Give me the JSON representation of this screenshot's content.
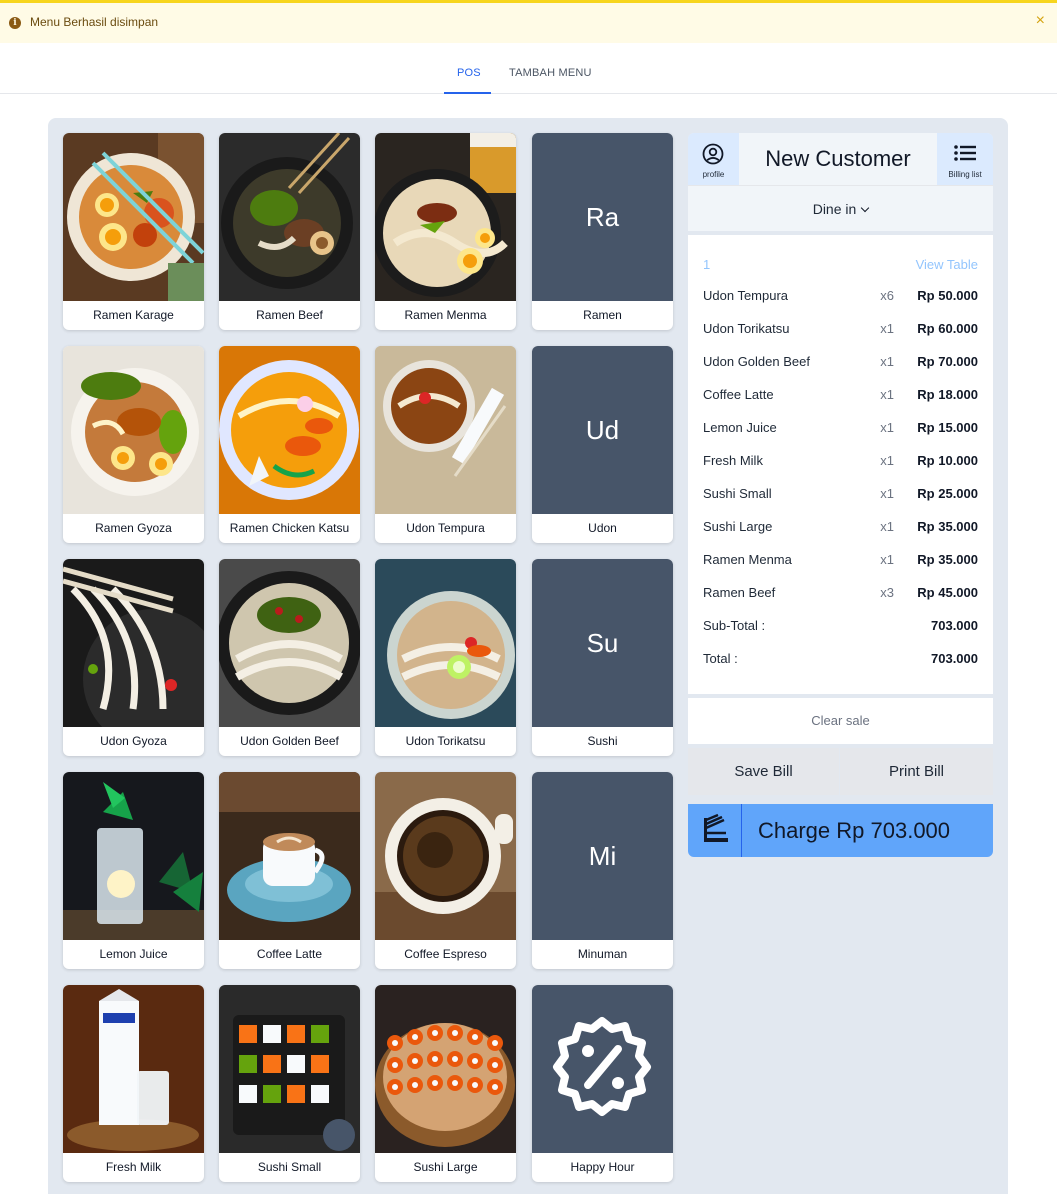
{
  "alert": {
    "text": "Menu Berhasil disimpan",
    "close_icon": "×"
  },
  "tabs": [
    {
      "label": "POS",
      "active": true
    },
    {
      "label": "TAMBAH MENU",
      "active": false
    }
  ],
  "menu": [
    {
      "label": "Ramen Karage",
      "kind": "photo"
    },
    {
      "label": "Ramen Beef",
      "kind": "photo"
    },
    {
      "label": "Ramen Menma",
      "kind": "photo"
    },
    {
      "label": "Ramen",
      "kind": "category",
      "abbr": "Ra"
    },
    {
      "label": "Ramen Gyoza",
      "kind": "photo"
    },
    {
      "label": "Ramen Chicken Katsu",
      "kind": "photo"
    },
    {
      "label": "Udon Tempura",
      "kind": "photo"
    },
    {
      "label": "Udon",
      "kind": "category",
      "abbr": "Ud"
    },
    {
      "label": "Udon Gyoza",
      "kind": "photo"
    },
    {
      "label": "Udon Golden Beef",
      "kind": "photo"
    },
    {
      "label": "Udon Torikatsu",
      "kind": "photo"
    },
    {
      "label": "Sushi",
      "kind": "category",
      "abbr": "Su"
    },
    {
      "label": "Lemon Juice",
      "kind": "photo"
    },
    {
      "label": "Coffee Latte",
      "kind": "photo"
    },
    {
      "label": "Coffee Espreso",
      "kind": "photo"
    },
    {
      "label": "Minuman",
      "kind": "category",
      "abbr": "Mi"
    },
    {
      "label": "Fresh Milk",
      "kind": "photo"
    },
    {
      "label": "Sushi Small",
      "kind": "photo"
    },
    {
      "label": "Sushi Large",
      "kind": "photo"
    },
    {
      "label": "Happy Hour",
      "kind": "promo",
      "icon": "discount-badge-icon"
    }
  ],
  "cart": {
    "profile_label": "profile",
    "title": "New Customer",
    "billing_label": "Billing list",
    "dine_option": "Dine in",
    "table_number": "1",
    "view_table": "View Table",
    "items": [
      {
        "name": "Udon Tempura",
        "qty": "x6",
        "price": "Rp 50.000"
      },
      {
        "name": "Udon Torikatsu",
        "qty": "x1",
        "price": "Rp 60.000"
      },
      {
        "name": "Udon Golden Beef",
        "qty": "x1",
        "price": "Rp 70.000"
      },
      {
        "name": "Coffee Latte",
        "qty": "x1",
        "price": "Rp 18.000"
      },
      {
        "name": "Lemon Juice",
        "qty": "x1",
        "price": "Rp 15.000"
      },
      {
        "name": "Fresh Milk",
        "qty": "x1",
        "price": "Rp 10.000"
      },
      {
        "name": "Sushi Small",
        "qty": "x1",
        "price": "Rp 25.000"
      },
      {
        "name": "Sushi Large",
        "qty": "x1",
        "price": "Rp 35.000"
      },
      {
        "name": "Ramen Menma",
        "qty": "x1",
        "price": "Rp 35.000"
      },
      {
        "name": "Ramen Beef",
        "qty": "x3",
        "price": "Rp 45.000"
      }
    ],
    "subtotal_label": "Sub-Total :",
    "subtotal_value": "703.000",
    "total_label": "Total :",
    "total_value": "703.000",
    "clear_sale": "Clear sale",
    "save_bill": "Save Bill",
    "print_bill": "Print Bill",
    "charge_label": "Charge Rp 703.000"
  },
  "colors": {
    "accent": "#2563eb",
    "charge": "#60a5fa",
    "category_tile": "#475569",
    "alert_bg": "#fffbe6"
  }
}
